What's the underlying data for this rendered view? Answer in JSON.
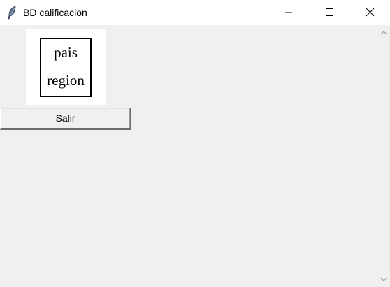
{
  "window": {
    "title": "BD calificacion",
    "icons": {
      "app": "feather-icon",
      "minimize": "minimize-icon",
      "maximize": "maximize-icon",
      "close": "close-icon"
    }
  },
  "diagram": {
    "cells": [
      "pais",
      "region"
    ]
  },
  "actions": {
    "exit_label": "Salir"
  },
  "scrollbar": {
    "icons": {
      "up": "chevron-up-icon",
      "down": "chevron-down-icon"
    }
  },
  "colors": {
    "titlebar": "#ffffff",
    "background": "#f0f0f0",
    "image_background": "#ffffff",
    "border": "#000000"
  }
}
